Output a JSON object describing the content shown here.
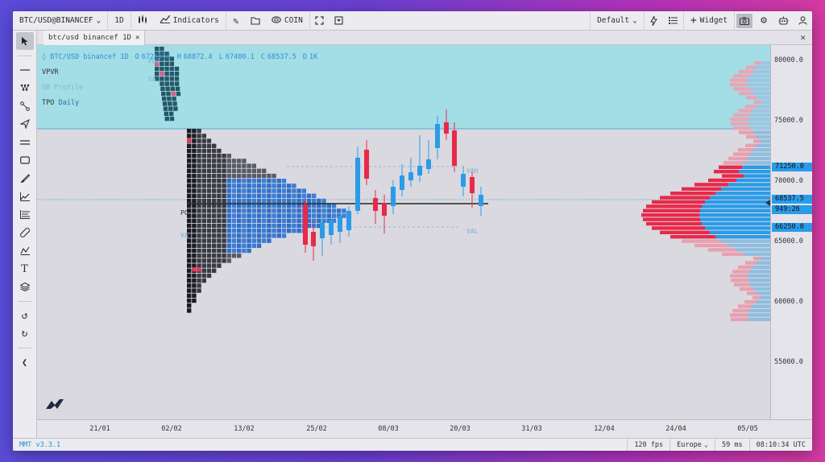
{
  "topbar": {
    "symbol": "BTC/USD@BINANCEF",
    "timeframe": "1D",
    "indicators_label": "Indicators",
    "currency_label": "COIN",
    "layout_label": "Default",
    "widget_label": "Widget"
  },
  "tab": {
    "label": "btc/usd binancef 1D"
  },
  "legend": {
    "symbol": "BTC/USD binancef 1D",
    "o_label": "O",
    "o_value": "67250.6",
    "h_label": "H",
    "h_value": "68872.4",
    "l_label": "L",
    "l_value": "67400.1",
    "c_label": "C",
    "c_value": "68537.5",
    "d_label": "D",
    "d_value": "1K",
    "indicators": [
      {
        "name": "VPVR",
        "value": ""
      },
      {
        "name": "OB Profile",
        "value": ""
      },
      {
        "name": "TPO",
        "value": "Daily"
      }
    ]
  },
  "chart_labels": {
    "poc": "POC",
    "va": "VA",
    "vah": "VAH",
    "val": "VAL",
    "poc2": "PO"
  },
  "price_axis": {
    "ticks": [
      "80000.0",
      "75000.0",
      "70000.0",
      "65000.0",
      "60000.0",
      "55000.0"
    ],
    "labels": [
      {
        "text": "71250.0",
        "kind": "level",
        "color": "#2a9be8"
      },
      {
        "text": "68537.5",
        "kind": "price",
        "color": "#2a9be8"
      },
      {
        "text": "949:26",
        "kind": "countdown",
        "color": "#2a9be8"
      },
      {
        "text": "66250.0",
        "kind": "level",
        "color": "#2a9be8"
      }
    ]
  },
  "time_axis": {
    "ticks": [
      "21/01",
      "02/02",
      "13/02",
      "25/02",
      "08/03",
      "20/03",
      "31/03",
      "12/04",
      "24/04",
      "05/05"
    ]
  },
  "status": {
    "version": "MMT v3.3.1",
    "fps": "120 fps",
    "region": "Europe",
    "latency": "59 ms",
    "clock": "08:10:34 UTC"
  },
  "colors": {
    "up": "#2a9be8",
    "down": "#e8294a",
    "highlight_band": "#a3dde6",
    "accent": "#2a8fd8"
  }
}
